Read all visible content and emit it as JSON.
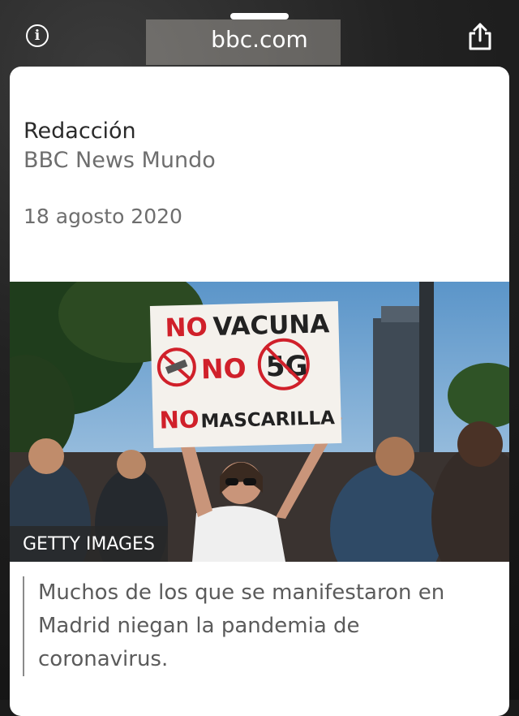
{
  "browser": {
    "url": "bbc.com",
    "info_icon": "info-icon",
    "share_icon": "share-icon"
  },
  "article": {
    "author": "Redacción",
    "outlet": "BBC News Mundo",
    "date": "18 agosto 2020",
    "image_credit": "GETTY IMAGES",
    "image_caption": "Muchos de los que se manifestaron en Madrid niegan la pandemia de coronavirus."
  },
  "sign": {
    "line1": "NO VACUNA",
    "line2_no": "NO",
    "line2_5g": "5G",
    "line3": "MASCARILLA"
  }
}
